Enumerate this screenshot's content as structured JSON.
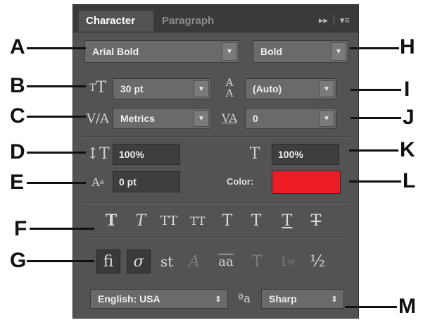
{
  "tabs": {
    "active": "Character",
    "inactive": "Paragraph"
  },
  "font": {
    "family": "Arial Bold",
    "style": "Bold"
  },
  "size": {
    "font_size": "30 pt",
    "leading": "(Auto)"
  },
  "spacing": {
    "kerning": "Metrics",
    "tracking": "0"
  },
  "scale": {
    "vertical": "100%",
    "horizontal": "100%"
  },
  "baseline": {
    "shift": "0 pt"
  },
  "color": {
    "label": "Color:",
    "value": "#ee1c25"
  },
  "styles": {
    "bold": "T",
    "italic": "T",
    "all_caps": "TT",
    "small_caps": "TT",
    "superscript": "T",
    "subscript": "T",
    "underline": "T",
    "strikethrough": "T"
  },
  "opentype": {
    "ligature": "fi",
    "discretionary": "st",
    "titling": "T",
    "ordinal": "st",
    "fraction": "½"
  },
  "language": {
    "value": "English: USA"
  },
  "antialias": {
    "value": "Sharp"
  },
  "callouts": [
    "A",
    "B",
    "C",
    "D",
    "E",
    "F",
    "G",
    "H",
    "I",
    "J",
    "K",
    "L",
    "M"
  ],
  "icons": {
    "size": "font-size-icon",
    "leading": "leading-icon",
    "kerning": "kerning-icon",
    "tracking": "tracking-icon",
    "vscale": "vertical-scale-icon",
    "hscale": "horizontal-scale-icon",
    "baseline": "baseline-shift-icon",
    "antialias": "antialias-icon"
  }
}
